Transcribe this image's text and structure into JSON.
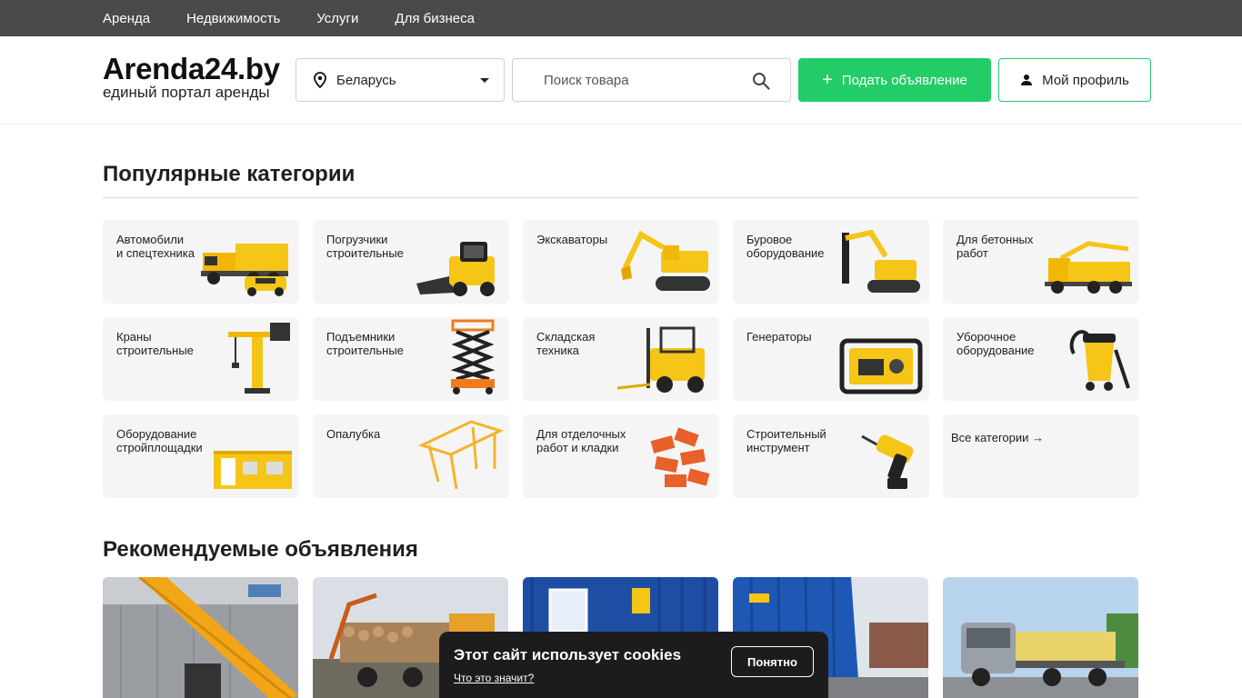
{
  "topnav": [
    "Аренда",
    "Недвижимость",
    "Услуги",
    "Для бизнеса"
  ],
  "logo": {
    "name": "Arenda24.by",
    "tagline": "единый портал аренды"
  },
  "region": {
    "value": "Беларусь",
    "icon": "location-pin-icon"
  },
  "search": {
    "placeholder": "Поиск товара",
    "icon": "search-icon"
  },
  "buttons": {
    "post": "Подать объявление",
    "profile": "Мой профиль"
  },
  "categories": {
    "title": "Популярные категории",
    "items": [
      {
        "label": "Автомобили\nи спецтехника",
        "icon": "trucks-icon"
      },
      {
        "label": "Погрузчики\nстроительные",
        "icon": "skid-loader-icon"
      },
      {
        "label": "Экскаваторы",
        "icon": "excavator-icon"
      },
      {
        "label": "Буровое\nоборудование",
        "icon": "drilling-rig-icon"
      },
      {
        "label": "Для бетонных\nработ",
        "icon": "concrete-pump-icon"
      },
      {
        "label": "Краны\nстроительные",
        "icon": "tower-crane-icon"
      },
      {
        "label": "Подъемники\nстроительные",
        "icon": "scissor-lift-icon"
      },
      {
        "label": "Складская\nтехника",
        "icon": "forklift-icon"
      },
      {
        "label": "Генераторы",
        "icon": "generator-icon"
      },
      {
        "label": "Уборочное\nоборудование",
        "icon": "vacuum-cleaner-icon"
      },
      {
        "label": "Оборудование\nстройплощадки",
        "icon": "site-cabin-icon"
      },
      {
        "label": "Опалубка",
        "icon": "formwork-icon"
      },
      {
        "label": "Для отделочных\nработ и кладки",
        "icon": "bricks-icon"
      },
      {
        "label": "Строительный\nинструмент",
        "icon": "drill-icon"
      },
      {
        "label": "Все категории →",
        "icon": "arrow-right-icon"
      }
    ]
  },
  "recommended": {
    "title": "Рекомендуемые объявления",
    "cards": [
      {
        "name": "listing-crane-truck"
      },
      {
        "name": "listing-timber-truck"
      },
      {
        "name": "listing-blue-container"
      },
      {
        "name": "listing-blue-container-2"
      },
      {
        "name": "listing-flatbed-truck"
      }
    ]
  },
  "cookie": {
    "title": "Этот сайт использует cookies",
    "link": "Что это значит?",
    "button": "Понятно"
  },
  "colors": {
    "accent": "#22cc66",
    "topnav": "#4a4a4a",
    "tile": "#f5f5f5",
    "illustration": "#f5c518"
  }
}
